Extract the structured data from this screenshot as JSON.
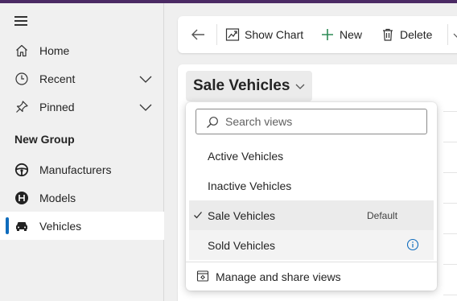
{
  "sidebar": {
    "items": [
      {
        "label": "Home",
        "icon": "home-icon"
      },
      {
        "label": "Recent",
        "icon": "clock-icon"
      },
      {
        "label": "Pinned",
        "icon": "pin-icon"
      }
    ],
    "group_title": "New Group",
    "group_items": [
      {
        "label": "Manufacturers",
        "icon": "steering-wheel-icon"
      },
      {
        "label": "Models",
        "icon": "gear-shift-icon"
      },
      {
        "label": "Vehicles",
        "icon": "car-icon",
        "selected": true
      }
    ]
  },
  "toolbar": {
    "show_chart": "Show Chart",
    "new": "New",
    "delete": "Delete"
  },
  "view": {
    "current": "Sale Vehicles"
  },
  "dropdown": {
    "search_placeholder": "Search views",
    "items": [
      {
        "label": "Active Vehicles"
      },
      {
        "label": "Inactive Vehicles"
      },
      {
        "label": "Sale Vehicles",
        "selected": true,
        "tag": "Default"
      },
      {
        "label": "Sold Vehicles",
        "info": true
      }
    ],
    "footer": "Manage and share views"
  },
  "colors": {
    "accent": "#0f6cbd",
    "topbar": "#4b2a64",
    "new_plus": "#2e8b57"
  }
}
